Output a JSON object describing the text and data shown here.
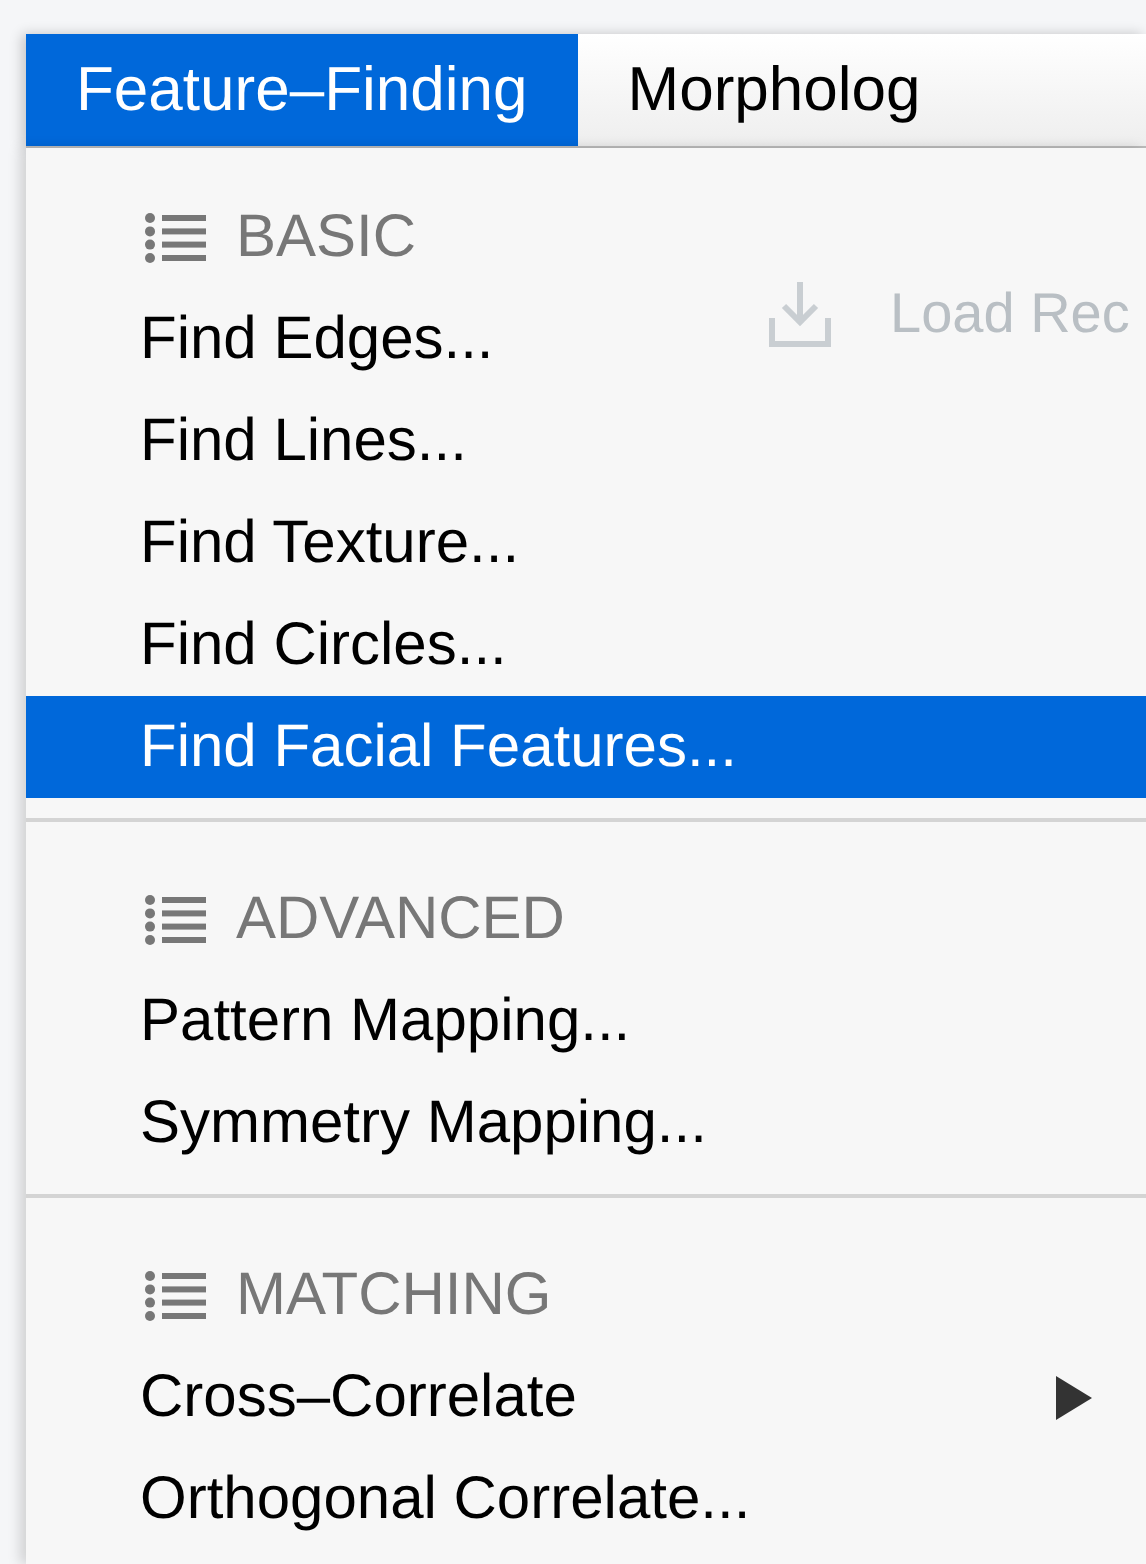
{
  "menu_bar": [
    {
      "label": "Feature–Finding",
      "selected": true
    },
    {
      "label": "Morpholog",
      "selected": false
    }
  ],
  "background": {
    "button_label": "Load Rec"
  },
  "menu": {
    "sections": [
      {
        "header": "BASIC",
        "items": [
          {
            "label": "Find Edges...",
            "selected": false,
            "kind": "action"
          },
          {
            "label": "Find Lines...",
            "selected": false,
            "kind": "action"
          },
          {
            "label": "Find Texture...",
            "selected": false,
            "kind": "action"
          },
          {
            "label": "Find Circles...",
            "selected": false,
            "kind": "action"
          },
          {
            "label": "Find Facial Features...",
            "selected": true,
            "kind": "action"
          }
        ]
      },
      {
        "header": "ADVANCED",
        "items": [
          {
            "label": "Pattern Mapping...",
            "selected": false,
            "kind": "action"
          },
          {
            "label": "Symmetry Mapping...",
            "selected": false,
            "kind": "action"
          }
        ]
      },
      {
        "header": "MATCHING",
        "items": [
          {
            "label": "Cross–Correlate",
            "selected": false,
            "kind": "submenu"
          },
          {
            "label": "Orthogonal Correlate...",
            "selected": false,
            "kind": "action"
          }
        ]
      }
    ]
  }
}
